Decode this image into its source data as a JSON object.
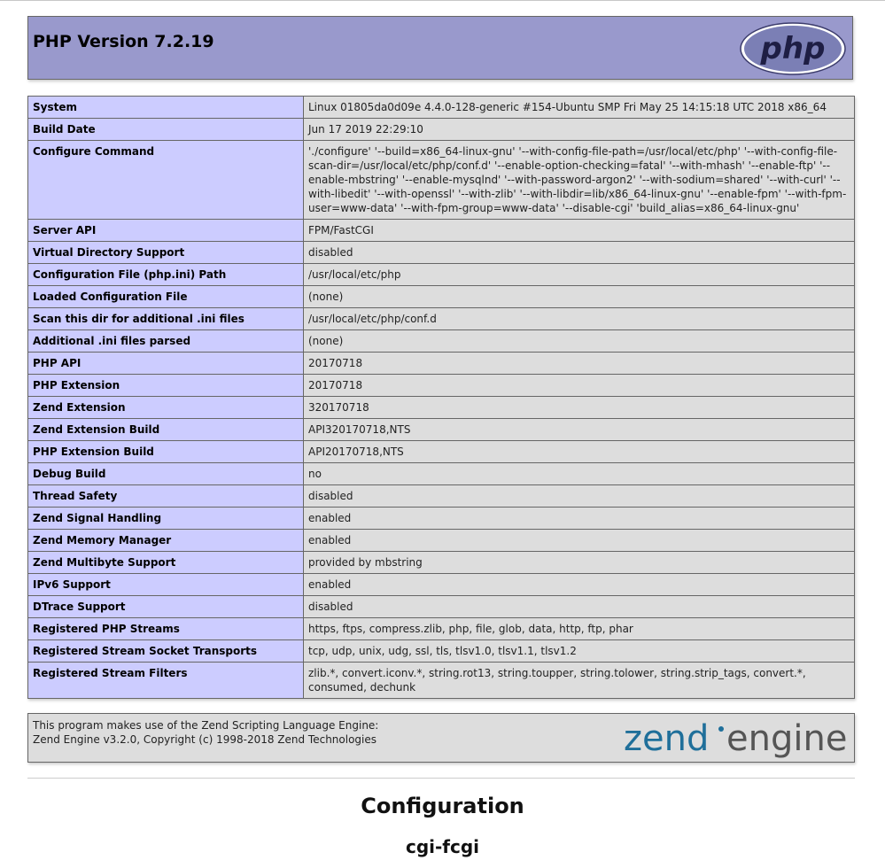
{
  "header": {
    "title": "PHP Version 7.2.19",
    "logo_text": "php"
  },
  "colors": {
    "header_bg": "#9999cc",
    "label_bg": "#ccccff",
    "value_bg": "#dddddd",
    "border": "#666666",
    "php_logo_text": "#1e1e44",
    "zend_blue": "#1f6f9a",
    "zend_gray": "#555555"
  },
  "info_rows": [
    {
      "label": "System",
      "value": "Linux 01805da0d09e 4.4.0-128-generic #154-Ubuntu SMP Fri May 25 14:15:18 UTC 2018 x86_64"
    },
    {
      "label": "Build Date",
      "value": "Jun 17 2019 22:29:10"
    },
    {
      "label": "Configure Command",
      "value": "'./configure' '--build=x86_64-linux-gnu' '--with-config-file-path=/usr/local/etc/php' '--with-config-file-scan-dir=/usr/local/etc/php/conf.d' '--enable-option-checking=fatal' '--with-mhash' '--enable-ftp' '--enable-mbstring' '--enable-mysqlnd' '--with-password-argon2' '--with-sodium=shared' '--with-curl' '--with-libedit' '--with-openssl' '--with-zlib' '--with-libdir=lib/x86_64-linux-gnu' '--enable-fpm' '--with-fpm-user=www-data' '--with-fpm-group=www-data' '--disable-cgi' 'build_alias=x86_64-linux-gnu'"
    },
    {
      "label": "Server API",
      "value": "FPM/FastCGI"
    },
    {
      "label": "Virtual Directory Support",
      "value": "disabled"
    },
    {
      "label": "Configuration File (php.ini) Path",
      "value": "/usr/local/etc/php"
    },
    {
      "label": "Loaded Configuration File",
      "value": "(none)"
    },
    {
      "label": "Scan this dir for additional .ini files",
      "value": "/usr/local/etc/php/conf.d"
    },
    {
      "label": "Additional .ini files parsed",
      "value": "(none)"
    },
    {
      "label": "PHP API",
      "value": "20170718"
    },
    {
      "label": "PHP Extension",
      "value": "20170718"
    },
    {
      "label": "Zend Extension",
      "value": "320170718"
    },
    {
      "label": "Zend Extension Build",
      "value": "API320170718,NTS"
    },
    {
      "label": "PHP Extension Build",
      "value": "API20170718,NTS"
    },
    {
      "label": "Debug Build",
      "value": "no"
    },
    {
      "label": "Thread Safety",
      "value": "disabled"
    },
    {
      "label": "Zend Signal Handling",
      "value": "enabled"
    },
    {
      "label": "Zend Memory Manager",
      "value": "enabled"
    },
    {
      "label": "Zend Multibyte Support",
      "value": "provided by mbstring"
    },
    {
      "label": "IPv6 Support",
      "value": "enabled"
    },
    {
      "label": "DTrace Support",
      "value": "disabled"
    },
    {
      "label": "Registered PHP Streams",
      "value": "https, ftps, compress.zlib, php, file, glob, data, http, ftp, phar"
    },
    {
      "label": "Registered Stream Socket Transports",
      "value": "tcp, udp, unix, udg, ssl, tls, tlsv1.0, tlsv1.1, tlsv1.2"
    },
    {
      "label": "Registered Stream Filters",
      "value": "zlib.*, convert.iconv.*, string.rot13, string.toupper, string.tolower, string.strip_tags, convert.*, consumed, dechunk"
    }
  ],
  "zend": {
    "line1": "This program makes use of the Zend Scripting Language Engine:",
    "line2": "Zend Engine v3.2.0, Copyright (c) 1998-2018 Zend Technologies",
    "logo_word1": "zend",
    "logo_word2": "engine"
  },
  "sections": {
    "configuration_title": "Configuration",
    "module_title": "cgi-fcgi"
  }
}
